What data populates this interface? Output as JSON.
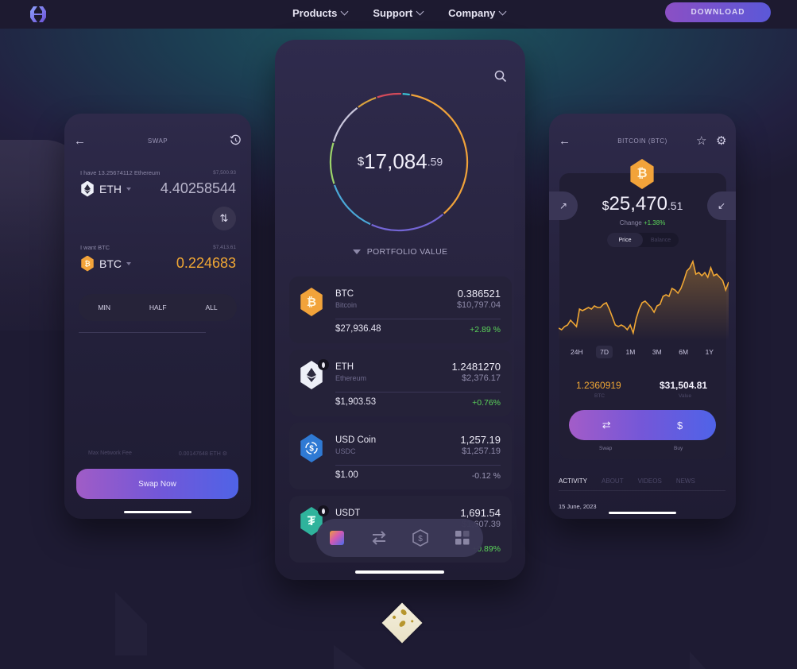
{
  "nav": {
    "logo_icon": "exodus-logo-icon",
    "links": [
      {
        "label": "Products",
        "icon": "chevron-down-icon"
      },
      {
        "label": "Support",
        "icon": "chevron-down-icon"
      },
      {
        "label": "Company",
        "icon": "chevron-down-icon"
      }
    ],
    "download_label": "DOWNLOAD"
  },
  "swap_screen": {
    "title": "SWAP",
    "back_icon": "arrow-left-icon",
    "history_icon": "history-icon",
    "from": {
      "label": "I have 13.25674112 Ethereum",
      "fiat": "$7,500.93",
      "token": "ETH",
      "amount": "4.40258544"
    },
    "to": {
      "label": "I want BTC",
      "fiat": "$7,413.61",
      "token": "BTC",
      "amount": "0.224683"
    },
    "swap_toggle_icon": "swap-vertical-icon",
    "chips": [
      "MIN",
      "HALF",
      "ALL"
    ],
    "fee_label": "Max Network Fee",
    "fee_value": "0.00147648 ETH",
    "fee_icon": "gear-icon",
    "swap_now_label": "Swap Now"
  },
  "portfolio_screen": {
    "search_icon": "search-icon",
    "total_currency": "$",
    "total_int": "17,084",
    "total_dec": ".59",
    "label": "PORTFOLIO VALUE",
    "donut_colors": [
      "#f1a33a",
      "#7466d6",
      "#4aa8d8",
      "#9cd36a",
      "#c9c6dc",
      "#d9a23e",
      "#d14a5a",
      "#3bc6d8"
    ],
    "assets": [
      {
        "symbol": "BTC",
        "name": "Bitcoin",
        "quantity": "0.386521",
        "value": "$10,797.04",
        "price": "$27,936.48",
        "change": "+2.89 %",
        "change_color": "#5bd45a",
        "icon": "bitcoin-icon"
      },
      {
        "symbol": "ETH",
        "name": "Ethereum",
        "quantity": "1.2481270",
        "value": "$2,376.17",
        "price": "$1,903.53",
        "change": "+0.76%",
        "change_color": "#5bd45a",
        "icon": "ethereum-icon"
      },
      {
        "symbol": "USD Coin",
        "name": "USDC",
        "quantity": "1,257.19",
        "value": "$1,257.19",
        "price": "$1.00",
        "change": "-0.12 %",
        "change_color": "#9c98b6",
        "icon": "usdc-icon"
      },
      {
        "symbol": "USDT",
        "name": "",
        "quantity": "1,691.54",
        "value": "$1,607.39",
        "price": "",
        "change": "+0.89%",
        "change_color": "#5bd45a",
        "icon": "tether-icon"
      }
    ],
    "bottom_nav": [
      "portfolio-icon",
      "exchange-icon",
      "coin-icon",
      "apps-icon"
    ]
  },
  "coin_screen": {
    "title": "BITCOIN (BTC)",
    "back_icon": "arrow-left-icon",
    "star_icon": "star-icon",
    "settings_icon": "gear-icon",
    "coin_icon": "bitcoin-icon",
    "price_currency": "$",
    "price_int": "25,470",
    "price_dec": ".51",
    "change_label": "Change",
    "change_value": "+1.38%",
    "send_icon": "arrow-up-right-icon",
    "receive_icon": "arrow-down-left-icon",
    "toggle": [
      "Price",
      "Balance"
    ],
    "ranges": [
      "24H",
      "7D",
      "1M",
      "3M",
      "6M",
      "1Y"
    ],
    "selected_range": "7D",
    "holding_amount": "1.2360919",
    "holding_unit": "BTC",
    "holding_value": "$31,504.81",
    "holding_value_label": "Value",
    "actions": [
      {
        "label": "Swap",
        "icon": "swap-icon"
      },
      {
        "label": "Buy",
        "icon": "dollar-icon"
      }
    ],
    "tabs": [
      "ACTIVITY",
      "ABOUT",
      "VIDEOS",
      "NEWS"
    ],
    "active_tab": "ACTIVITY",
    "activity_date": "15 June, 2023"
  },
  "chart_data": {
    "type": "line",
    "title": "",
    "series": [
      {
        "name": "BTC price (7D)",
        "values": [
          28,
          27,
          29,
          30,
          33,
          31,
          29,
          40,
          39,
          40,
          41,
          40,
          42,
          41,
          41,
          43,
          44,
          40,
          35,
          30,
          29,
          30,
          29,
          27,
          30,
          25,
          34,
          40,
          44,
          45,
          43,
          41,
          38,
          42,
          43,
          48,
          49,
          48,
          53,
          52,
          50,
          53,
          58,
          64,
          66,
          70,
          62,
          63,
          61,
          63,
          60,
          66,
          61,
          62,
          60,
          58,
          52,
          57
        ]
      }
    ],
    "x": "7D",
    "ylim": [
      20,
      75
    ],
    "color": "#f0a734",
    "fill": true
  }
}
